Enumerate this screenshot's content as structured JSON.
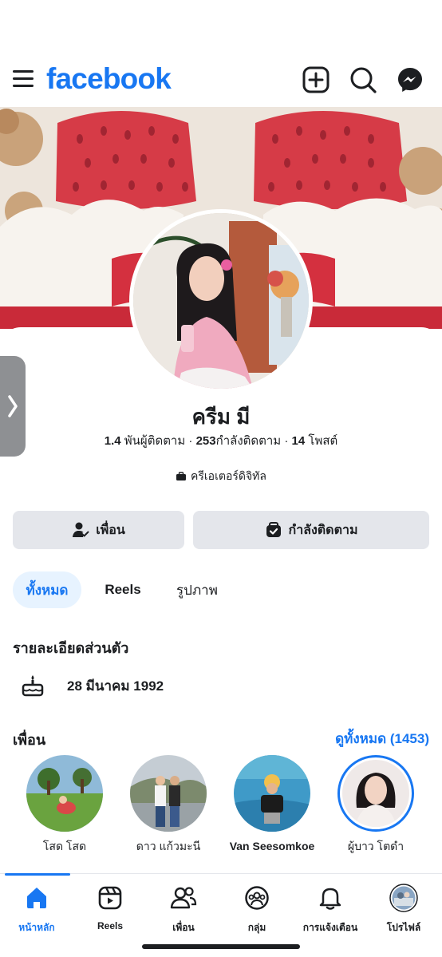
{
  "header": {
    "logo": "facebook",
    "icons": [
      "menu-icon",
      "create-icon",
      "search-icon",
      "messenger-icon"
    ],
    "accent": "#1877f2"
  },
  "profile": {
    "name": "ครีม มี",
    "followers_count": "1.4",
    "followers_label": "พันผู้ติดตาม",
    "following_count": "253",
    "following_label": "กำลังติดตาม",
    "posts_count": "14",
    "posts_label": "โพสต์",
    "category": "ครีเอเตอร์ดิจิทัล"
  },
  "actions": {
    "friends_label": "เพื่อน",
    "following_label": "กำลังติดตาม"
  },
  "tabs": [
    {
      "label": "ทั้งหมด",
      "active": true
    },
    {
      "label": "Reels",
      "active": false
    },
    {
      "label": "รูปภาพ",
      "active": false
    }
  ],
  "details": {
    "title": "รายละเอียดส่วนตัว",
    "birthday": "28 มีนาคม 1992"
  },
  "friends": {
    "title": "เพื่อน",
    "see_all": "ดูทั้งหมด (1453)",
    "items": [
      {
        "name": "โสด โสด"
      },
      {
        "name": "ดาว แก้วมะนี"
      },
      {
        "name": "Van Seesomkoe"
      },
      {
        "name": "ผู้บาว โตดำ"
      }
    ]
  },
  "nav": {
    "items": [
      {
        "label": "หน้าหลัก",
        "icon": "home-icon",
        "active": true
      },
      {
        "label": "Reels",
        "icon": "reels-icon",
        "active": false
      },
      {
        "label": "เพื่อน",
        "icon": "friends-icon",
        "active": false
      },
      {
        "label": "กลุ่ม",
        "icon": "groups-icon",
        "active": false
      },
      {
        "label": "การแจ้งเตือน",
        "icon": "bell-icon",
        "active": false
      },
      {
        "label": "โปรไฟล์",
        "icon": "profile-icon",
        "active": false
      }
    ]
  }
}
